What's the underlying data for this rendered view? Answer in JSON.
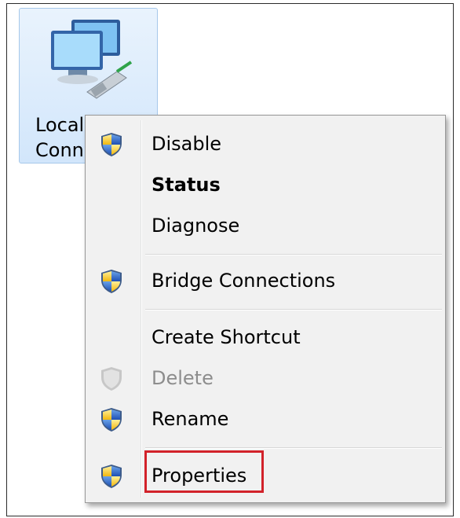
{
  "connection": {
    "label_line1": "Local A",
    "label_line2": "Conn",
    "icon": "network-adapter-icon"
  },
  "menu": {
    "items": [
      {
        "label": "Disable",
        "icon": "uac-shield-icon",
        "bold": false,
        "enabled": true
      },
      {
        "label": "Status",
        "icon": null,
        "bold": true,
        "enabled": true
      },
      {
        "label": "Diagnose",
        "icon": null,
        "bold": false,
        "enabled": true
      },
      {
        "label": "Bridge Connections",
        "icon": "uac-shield-icon",
        "bold": false,
        "enabled": true
      },
      {
        "label": "Create Shortcut",
        "icon": null,
        "bold": false,
        "enabled": true
      },
      {
        "label": "Delete",
        "icon": "uac-shield-icon",
        "bold": false,
        "enabled": false
      },
      {
        "label": "Rename",
        "icon": "uac-shield-icon",
        "bold": false,
        "enabled": true
      },
      {
        "label": "Properties",
        "icon": "uac-shield-icon",
        "bold": false,
        "enabled": true,
        "highlighted": true
      }
    ]
  },
  "colors": {
    "highlight_box": "#d2222a",
    "selection_bg": "#dbeafc",
    "menu_bg": "#f1f1f1"
  }
}
